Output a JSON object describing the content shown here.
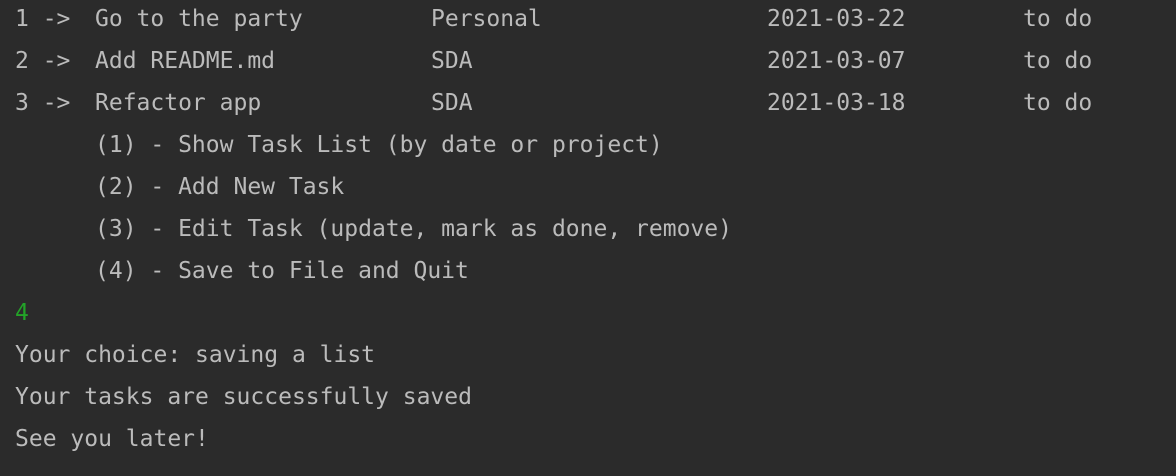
{
  "tasks": [
    {
      "num": "1 ->",
      "title": "Go to the party",
      "project": "Personal",
      "date": "2021-03-22",
      "status": "to do"
    },
    {
      "num": "2 ->",
      "title": "Add README.md",
      "project": "SDA",
      "date": "2021-03-07",
      "status": "to do"
    },
    {
      "num": "3 ->",
      "title": "Refactor app",
      "project": "SDA",
      "date": "2021-03-18",
      "status": "to do"
    }
  ],
  "menu": [
    "(1) - Show Task List (by date or project)",
    "(2) - Add New Task",
    "(3) - Edit Task (update, mark as done, remove)",
    "(4) - Save to File and Quit"
  ],
  "user_input": "4",
  "messages": [
    "Your choice: saving a list",
    "Your tasks are successfully saved",
    "See you later!"
  ],
  "colors": {
    "background": "#2b2b2b",
    "text": "#bbbbbb",
    "input": "#23a328"
  }
}
